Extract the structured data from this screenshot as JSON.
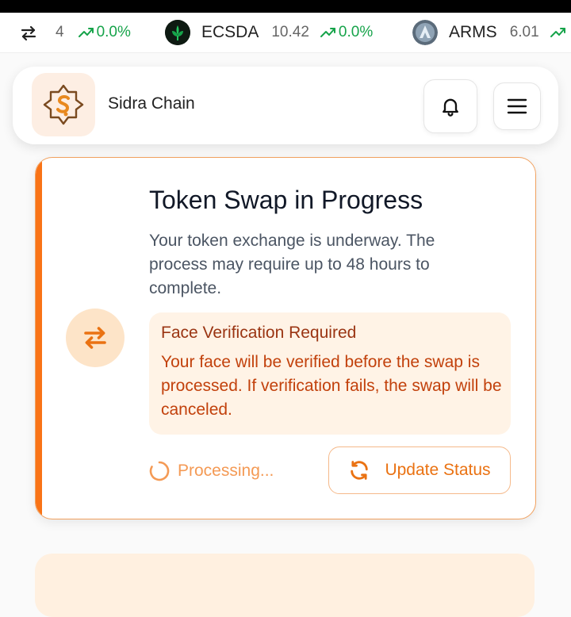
{
  "ticker": {
    "items": [
      {
        "symbol": "",
        "price": "4",
        "change": "0.0%",
        "logo": "unknown-coin-logo"
      },
      {
        "symbol": "ECSDA",
        "price": "10.42",
        "change": "0.0%",
        "logo": "ecsda-logo"
      },
      {
        "symbol": "ARMS",
        "price": "6.01",
        "change": "",
        "logo": "arms-logo"
      }
    ],
    "icon": "swap-arrows-icon",
    "up_color": "#16a34a"
  },
  "header": {
    "brand_name": "Sidra Chain",
    "icons": [
      "sidra-logo",
      "bell-icon",
      "menu-icon"
    ]
  },
  "swap_card": {
    "title": "Token Swap in Progress",
    "description": "Your token exchange is underway. The process may require up to 48 hours to complete.",
    "notice": {
      "title": "Face Verification Required",
      "body": "Your face will be verified before the swap is processed. If verification fails, the swap will be canceled."
    },
    "status_text": "Processing...",
    "update_button_label": "Update Status",
    "accent_color": "#f97316"
  }
}
